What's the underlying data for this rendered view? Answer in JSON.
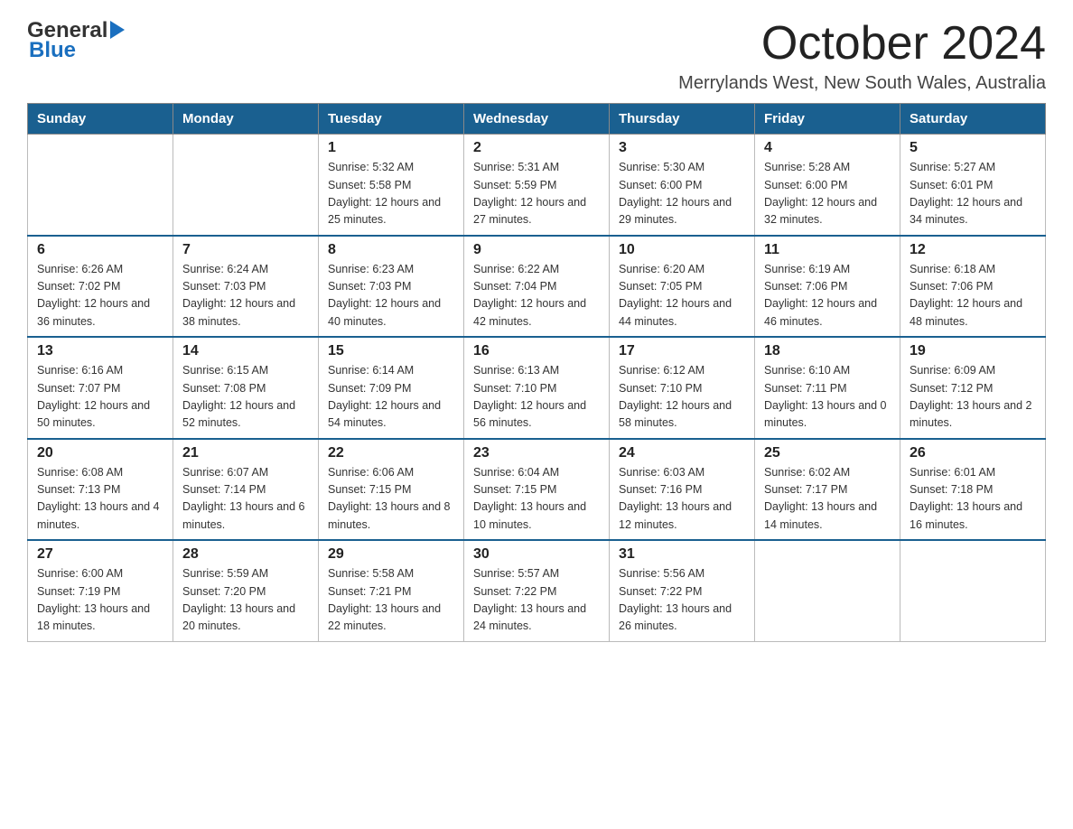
{
  "header": {
    "logo_general": "General",
    "logo_blue": "Blue",
    "month_title": "October 2024",
    "location": "Merrylands West, New South Wales, Australia"
  },
  "days_of_week": [
    "Sunday",
    "Monday",
    "Tuesday",
    "Wednesday",
    "Thursday",
    "Friday",
    "Saturday"
  ],
  "weeks": [
    [
      {
        "day": "",
        "sunrise": "",
        "sunset": "",
        "daylight": ""
      },
      {
        "day": "",
        "sunrise": "",
        "sunset": "",
        "daylight": ""
      },
      {
        "day": "1",
        "sunrise": "Sunrise: 5:32 AM",
        "sunset": "Sunset: 5:58 PM",
        "daylight": "Daylight: 12 hours and 25 minutes."
      },
      {
        "day": "2",
        "sunrise": "Sunrise: 5:31 AM",
        "sunset": "Sunset: 5:59 PM",
        "daylight": "Daylight: 12 hours and 27 minutes."
      },
      {
        "day": "3",
        "sunrise": "Sunrise: 5:30 AM",
        "sunset": "Sunset: 6:00 PM",
        "daylight": "Daylight: 12 hours and 29 minutes."
      },
      {
        "day": "4",
        "sunrise": "Sunrise: 5:28 AM",
        "sunset": "Sunset: 6:00 PM",
        "daylight": "Daylight: 12 hours and 32 minutes."
      },
      {
        "day": "5",
        "sunrise": "Sunrise: 5:27 AM",
        "sunset": "Sunset: 6:01 PM",
        "daylight": "Daylight: 12 hours and 34 minutes."
      }
    ],
    [
      {
        "day": "6",
        "sunrise": "Sunrise: 6:26 AM",
        "sunset": "Sunset: 7:02 PM",
        "daylight": "Daylight: 12 hours and 36 minutes."
      },
      {
        "day": "7",
        "sunrise": "Sunrise: 6:24 AM",
        "sunset": "Sunset: 7:03 PM",
        "daylight": "Daylight: 12 hours and 38 minutes."
      },
      {
        "day": "8",
        "sunrise": "Sunrise: 6:23 AM",
        "sunset": "Sunset: 7:03 PM",
        "daylight": "Daylight: 12 hours and 40 minutes."
      },
      {
        "day": "9",
        "sunrise": "Sunrise: 6:22 AM",
        "sunset": "Sunset: 7:04 PM",
        "daylight": "Daylight: 12 hours and 42 minutes."
      },
      {
        "day": "10",
        "sunrise": "Sunrise: 6:20 AM",
        "sunset": "Sunset: 7:05 PM",
        "daylight": "Daylight: 12 hours and 44 minutes."
      },
      {
        "day": "11",
        "sunrise": "Sunrise: 6:19 AM",
        "sunset": "Sunset: 7:06 PM",
        "daylight": "Daylight: 12 hours and 46 minutes."
      },
      {
        "day": "12",
        "sunrise": "Sunrise: 6:18 AM",
        "sunset": "Sunset: 7:06 PM",
        "daylight": "Daylight: 12 hours and 48 minutes."
      }
    ],
    [
      {
        "day": "13",
        "sunrise": "Sunrise: 6:16 AM",
        "sunset": "Sunset: 7:07 PM",
        "daylight": "Daylight: 12 hours and 50 minutes."
      },
      {
        "day": "14",
        "sunrise": "Sunrise: 6:15 AM",
        "sunset": "Sunset: 7:08 PM",
        "daylight": "Daylight: 12 hours and 52 minutes."
      },
      {
        "day": "15",
        "sunrise": "Sunrise: 6:14 AM",
        "sunset": "Sunset: 7:09 PM",
        "daylight": "Daylight: 12 hours and 54 minutes."
      },
      {
        "day": "16",
        "sunrise": "Sunrise: 6:13 AM",
        "sunset": "Sunset: 7:10 PM",
        "daylight": "Daylight: 12 hours and 56 minutes."
      },
      {
        "day": "17",
        "sunrise": "Sunrise: 6:12 AM",
        "sunset": "Sunset: 7:10 PM",
        "daylight": "Daylight: 12 hours and 58 minutes."
      },
      {
        "day": "18",
        "sunrise": "Sunrise: 6:10 AM",
        "sunset": "Sunset: 7:11 PM",
        "daylight": "Daylight: 13 hours and 0 minutes."
      },
      {
        "day": "19",
        "sunrise": "Sunrise: 6:09 AM",
        "sunset": "Sunset: 7:12 PM",
        "daylight": "Daylight: 13 hours and 2 minutes."
      }
    ],
    [
      {
        "day": "20",
        "sunrise": "Sunrise: 6:08 AM",
        "sunset": "Sunset: 7:13 PM",
        "daylight": "Daylight: 13 hours and 4 minutes."
      },
      {
        "day": "21",
        "sunrise": "Sunrise: 6:07 AM",
        "sunset": "Sunset: 7:14 PM",
        "daylight": "Daylight: 13 hours and 6 minutes."
      },
      {
        "day": "22",
        "sunrise": "Sunrise: 6:06 AM",
        "sunset": "Sunset: 7:15 PM",
        "daylight": "Daylight: 13 hours and 8 minutes."
      },
      {
        "day": "23",
        "sunrise": "Sunrise: 6:04 AM",
        "sunset": "Sunset: 7:15 PM",
        "daylight": "Daylight: 13 hours and 10 minutes."
      },
      {
        "day": "24",
        "sunrise": "Sunrise: 6:03 AM",
        "sunset": "Sunset: 7:16 PM",
        "daylight": "Daylight: 13 hours and 12 minutes."
      },
      {
        "day": "25",
        "sunrise": "Sunrise: 6:02 AM",
        "sunset": "Sunset: 7:17 PM",
        "daylight": "Daylight: 13 hours and 14 minutes."
      },
      {
        "day": "26",
        "sunrise": "Sunrise: 6:01 AM",
        "sunset": "Sunset: 7:18 PM",
        "daylight": "Daylight: 13 hours and 16 minutes."
      }
    ],
    [
      {
        "day": "27",
        "sunrise": "Sunrise: 6:00 AM",
        "sunset": "Sunset: 7:19 PM",
        "daylight": "Daylight: 13 hours and 18 minutes."
      },
      {
        "day": "28",
        "sunrise": "Sunrise: 5:59 AM",
        "sunset": "Sunset: 7:20 PM",
        "daylight": "Daylight: 13 hours and 20 minutes."
      },
      {
        "day": "29",
        "sunrise": "Sunrise: 5:58 AM",
        "sunset": "Sunset: 7:21 PM",
        "daylight": "Daylight: 13 hours and 22 minutes."
      },
      {
        "day": "30",
        "sunrise": "Sunrise: 5:57 AM",
        "sunset": "Sunset: 7:22 PM",
        "daylight": "Daylight: 13 hours and 24 minutes."
      },
      {
        "day": "31",
        "sunrise": "Sunrise: 5:56 AM",
        "sunset": "Sunset: 7:22 PM",
        "daylight": "Daylight: 13 hours and 26 minutes."
      },
      {
        "day": "",
        "sunrise": "",
        "sunset": "",
        "daylight": ""
      },
      {
        "day": "",
        "sunrise": "",
        "sunset": "",
        "daylight": ""
      }
    ]
  ]
}
